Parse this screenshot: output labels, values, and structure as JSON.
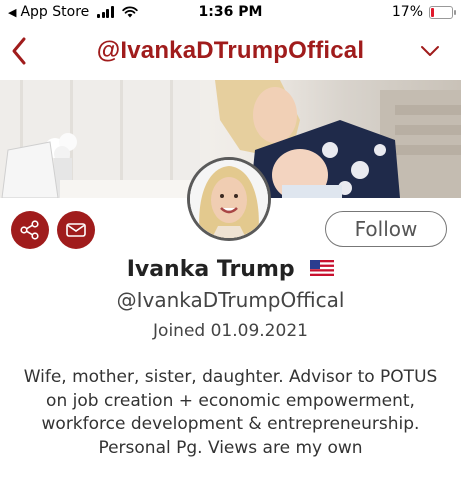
{
  "status_bar": {
    "back_app": "App Store",
    "time": "1:36 PM",
    "battery_percent": "17%",
    "battery_level": 0.17,
    "battery_color": "#e0192b"
  },
  "nav": {
    "title": "@IvankaDTrumpOffical",
    "back_icon": "chevron-left-icon",
    "menu_icon": "chevron-down-icon",
    "accent_color": "#a01c1c"
  },
  "profile": {
    "name": "Ivanka Trump",
    "flag_icon": "us-flag-icon",
    "handle": "@IvankaDTrumpOffical",
    "joined": "Joined 01.09.2021",
    "bio": "Wife, mother, sister, daughter. Advisor to POTUS on job creation + economic empowerment, workforce development & entrepreneurship. Personal Pg. Views are my own"
  },
  "actions": {
    "share_icon": "share-icon",
    "mail_icon": "mail-icon",
    "follow_label": "Follow"
  }
}
